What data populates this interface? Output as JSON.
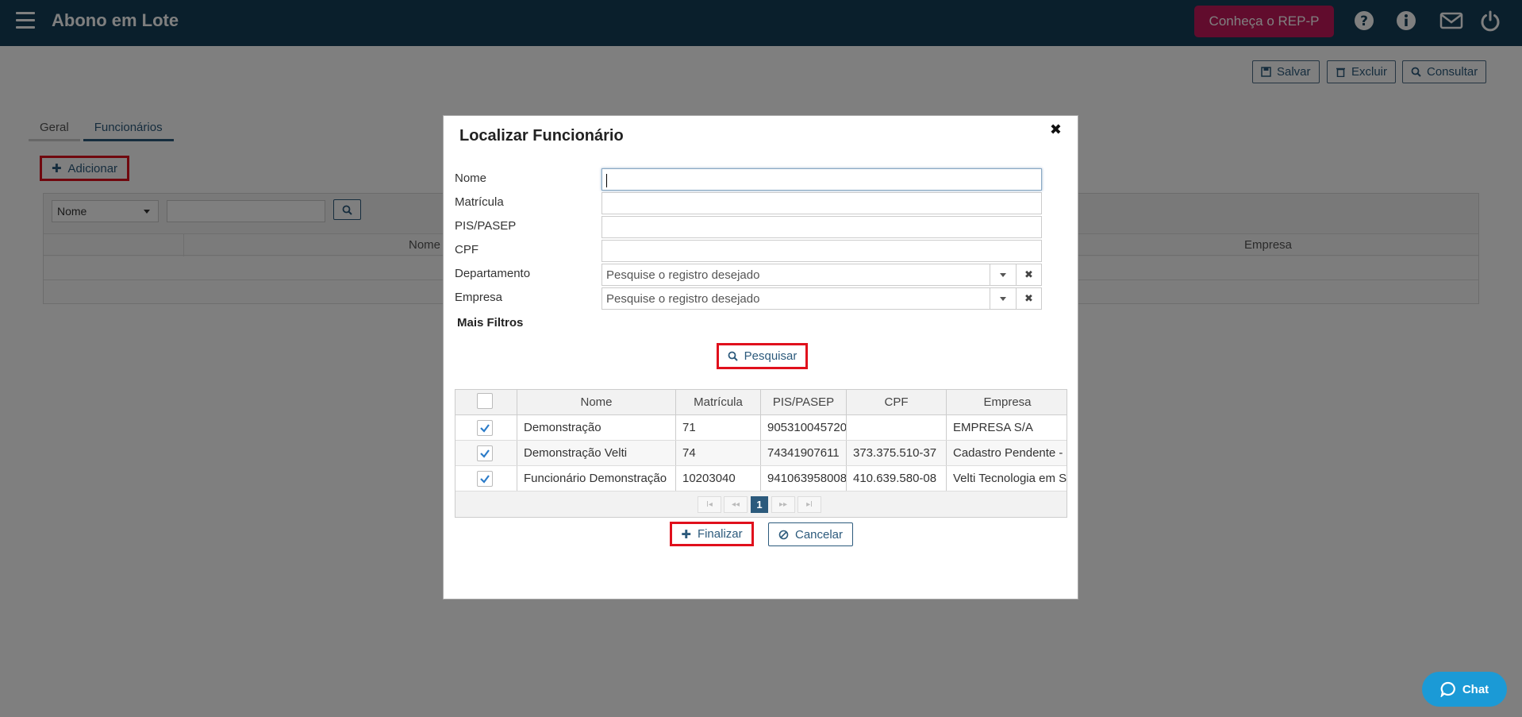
{
  "header": {
    "app_title": "Abono em Lote",
    "rep_button": "Conheça o REP-P",
    "icons": [
      "help-icon",
      "info-icon",
      "mail-icon",
      "power-icon"
    ]
  },
  "toolbar": {
    "save": "Salvar",
    "delete": "Excluir",
    "query": "Consultar"
  },
  "tabs": [
    {
      "label": "Geral"
    },
    {
      "label": "Funcionários",
      "active": true
    }
  ],
  "add_button": "Adicionar",
  "background_grid": {
    "filter_select": "Nome",
    "col_nome": "Nome",
    "col_empresa": "Empresa"
  },
  "modal": {
    "title": "Localizar Funcionário",
    "close": "✖",
    "fields": {
      "nome": {
        "label": "Nome",
        "value": ""
      },
      "matricula": {
        "label": "Matrícula",
        "value": ""
      },
      "pis": {
        "label": "PIS/PASEP",
        "value": ""
      },
      "cpf": {
        "label": "CPF",
        "value": ""
      },
      "departamento": {
        "label": "Departamento",
        "placeholder": "Pesquise o registro desejado"
      },
      "empresa": {
        "label": "Empresa",
        "placeholder": "Pesquise o registro desejado"
      }
    },
    "more_filters": "Mais Filtros",
    "search_button": "Pesquisar",
    "grid": {
      "columns": [
        "Nome",
        "Matrícula",
        "PIS/PASEP",
        "CPF",
        "Empresa"
      ],
      "rows": [
        {
          "checked": true,
          "nome": "Demonstração",
          "matricula": "71",
          "pis": "905310045720",
          "cpf": "",
          "empresa": "EMPRESA S/A"
        },
        {
          "checked": true,
          "nome": "Demonstração Velti",
          "matricula": "74",
          "pis": "74341907611",
          "cpf": "373.375.510-37",
          "empresa": "Cadastro Pendente -"
        },
        {
          "checked": true,
          "nome": "Funcionário Demonstração",
          "matricula": "10203040",
          "pis": "941063958008",
          "cpf": "410.639.580-08",
          "empresa": "Velti Tecnologia em S"
        }
      ],
      "pager": {
        "first": "I◂",
        "prev": "◂◂",
        "current": "1",
        "next": "▸▸",
        "last": "▸I"
      }
    },
    "finish_button": "Finalizar",
    "cancel_button": "Cancelar"
  },
  "chat_button": "Chat",
  "colors": {
    "header_bg": "#143f58",
    "rep_button": "#c2185b",
    "accent": "#2c5a7c",
    "highlight_border": "#e0101c",
    "chat_button": "#1b9ad6"
  }
}
